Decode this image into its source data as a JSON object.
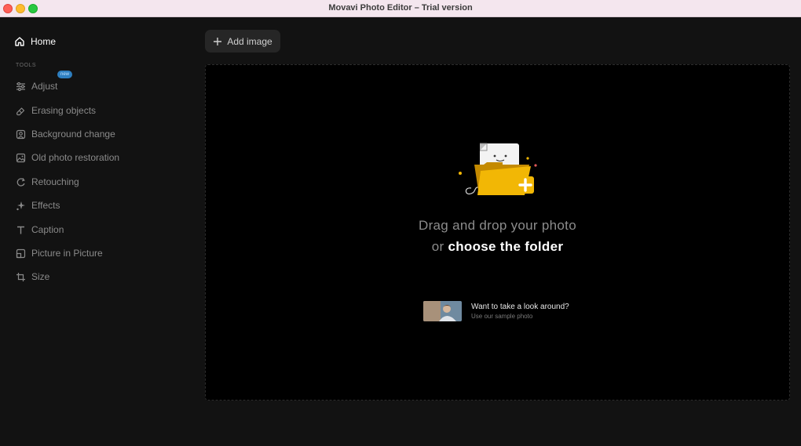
{
  "window": {
    "title": "Movavi Photo Editor – Trial version"
  },
  "sidebar": {
    "home_label": "Home",
    "tools_label": "TOOLS",
    "badge_new": "new",
    "items": [
      {
        "label": "Adjust",
        "icon": "sliders-icon"
      },
      {
        "label": "Erasing objects",
        "icon": "eraser-icon"
      },
      {
        "label": "Background change",
        "icon": "portrait-icon"
      },
      {
        "label": "Old photo restoration",
        "icon": "photo-icon"
      },
      {
        "label": "Retouching",
        "icon": "retouch-icon"
      },
      {
        "label": "Effects",
        "icon": "sparkle-icon"
      },
      {
        "label": "Caption",
        "icon": "text-icon"
      },
      {
        "label": "Picture in Picture",
        "icon": "pip-icon"
      },
      {
        "label": "Size",
        "icon": "crop-icon"
      }
    ]
  },
  "toolbar": {
    "add_image_label": "Add image"
  },
  "dropzone": {
    "line1": "Drag and drop your photo",
    "or": "or",
    "choose": "choose the folder"
  },
  "sample": {
    "title": "Want to take a look around?",
    "subtitle": "Use our sample photo"
  },
  "colors": {
    "accent_yellow": "#f2b705",
    "badge_blue": "#2e7fc0",
    "background": "#121212",
    "dropzone": "#000000"
  }
}
